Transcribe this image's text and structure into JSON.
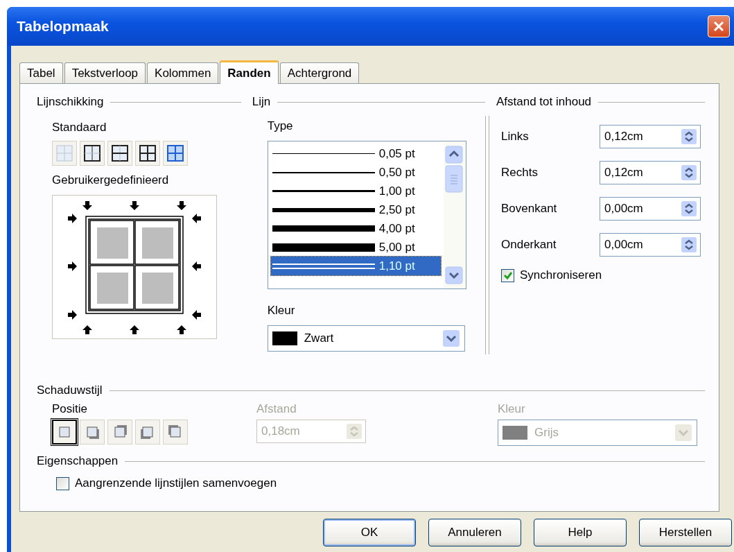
{
  "window": {
    "title": "Tabelopmaak"
  },
  "tabs": [
    {
      "label": "Tabel",
      "selected": false
    },
    {
      "label": "Tekstverloop",
      "selected": false
    },
    {
      "label": "Kolommen",
      "selected": false
    },
    {
      "label": "Randen",
      "selected": true
    },
    {
      "label": "Achtergrond",
      "selected": false
    }
  ],
  "line_arrangement": {
    "title": "Lijnschikking",
    "default_label": "Standaard",
    "presets": [
      {
        "kind": "none"
      },
      {
        "kind": "outer"
      },
      {
        "kind": "outer-horizontal"
      },
      {
        "kind": "all"
      },
      {
        "kind": "outer-inner"
      }
    ],
    "custom_label": "Gebruikergedefinieerd"
  },
  "line": {
    "title": "Lijn",
    "type_label": "Type",
    "styles": [
      {
        "label": "0,05 pt",
        "kind": "hairline",
        "selected": false
      },
      {
        "label": "0,50 pt",
        "kind": "thin",
        "selected": false
      },
      {
        "label": "1,00 pt",
        "kind": "medium",
        "selected": false
      },
      {
        "label": "2,50 pt",
        "kind": "thick",
        "selected": false
      },
      {
        "label": "4,00 pt",
        "kind": "heavy",
        "selected": false
      },
      {
        "label": "5,00 pt",
        "kind": "bold",
        "selected": false
      },
      {
        "label": "1,10 pt",
        "kind": "double",
        "selected": true
      }
    ],
    "color_label": "Kleur",
    "color": {
      "value": "Zwart",
      "color": "#000000"
    }
  },
  "spacing": {
    "title": "Afstand tot inhoud",
    "fields": [
      {
        "label": "Links",
        "value": "0,12cm"
      },
      {
        "label": "Rechts",
        "value": "0,12cm"
      },
      {
        "label": "Bovenkant",
        "value": "0,00cm"
      },
      {
        "label": "Onderkant",
        "value": "0,00cm"
      }
    ],
    "synchronize": {
      "label": "Synchroniseren",
      "checked": true
    }
  },
  "shadow": {
    "title": "Schaduwstijl",
    "position_label": "Positie",
    "positions": [
      {
        "kind": "none",
        "selected": true
      },
      {
        "kind": "bottom-right",
        "selected": false
      },
      {
        "kind": "top-right",
        "selected": false
      },
      {
        "kind": "bottom-left",
        "selected": false
      },
      {
        "kind": "top-left",
        "selected": false
      }
    ],
    "distance_label": "Afstand",
    "distance_value": "0,18cm",
    "distance_disabled": true,
    "color_label": "Kleur",
    "color": {
      "value": "Grijs",
      "color": "#808080"
    },
    "color_disabled": true
  },
  "properties": {
    "title": "Eigenschappen",
    "merge": {
      "label": "Aangrenzende lijnstijlen samenvoegen",
      "checked": false
    }
  },
  "buttons": [
    {
      "label": "OK",
      "kind": "default"
    },
    {
      "label": "Annuleren",
      "kind": "normal"
    },
    {
      "label": "Help",
      "kind": "normal"
    },
    {
      "label": "Herstellen",
      "kind": "normal"
    }
  ]
}
